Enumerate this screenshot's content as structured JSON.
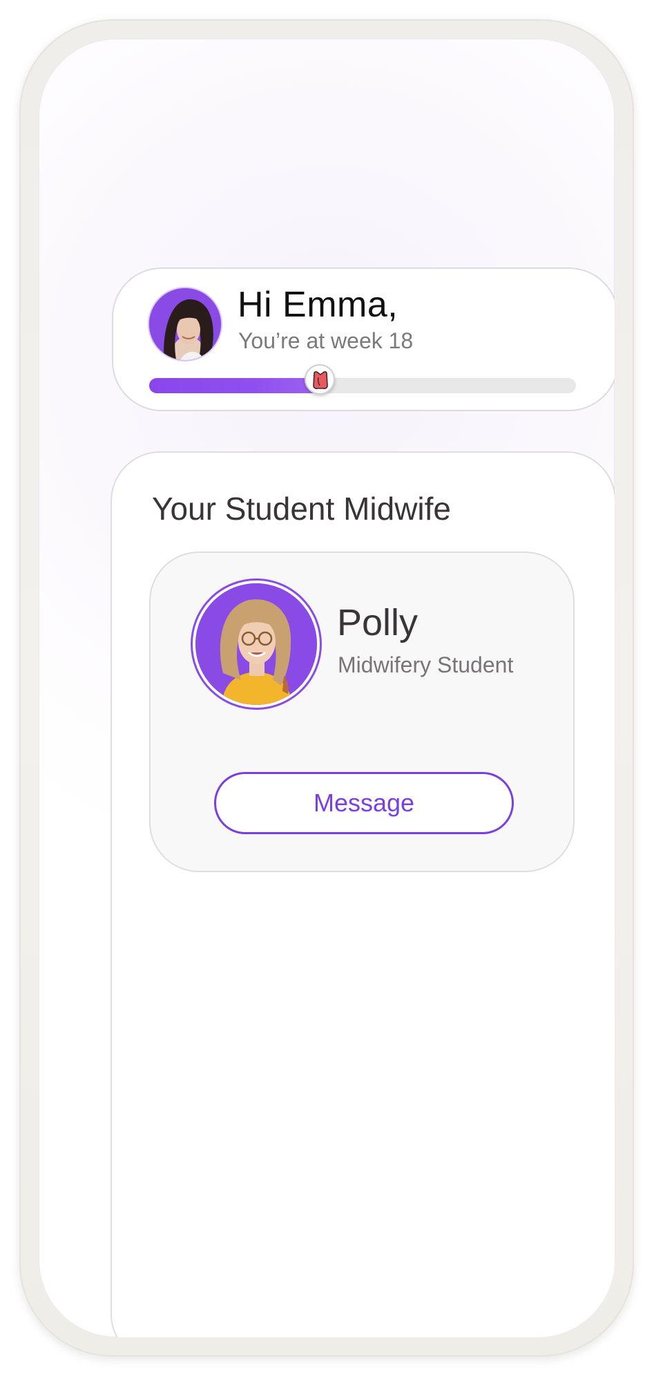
{
  "greeting": {
    "title": "Hi Emma,",
    "subtitle": "You’re at week 18",
    "progress_fraction": 0.4,
    "thumb_icon": "baby-icon"
  },
  "student_midwife": {
    "section_title": "Your Student Midwife",
    "name": "Polly",
    "role": "Midwifery Student",
    "message_label": "Message"
  },
  "colors": {
    "accent": "#8a46ea",
    "button_border": "#7a3fe0",
    "track": "#e8e8e8",
    "thumb_icon": "#e85a5f"
  }
}
